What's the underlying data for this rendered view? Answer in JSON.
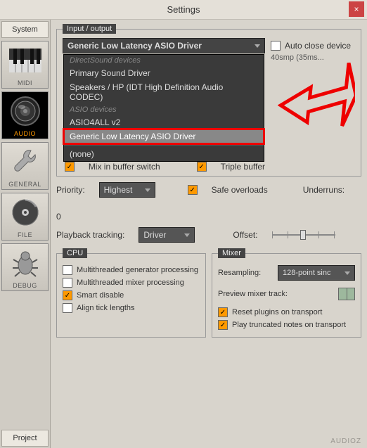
{
  "window": {
    "title": "Settings",
    "close": "×"
  },
  "sidebar": {
    "system": "System",
    "project": "Project",
    "items": [
      {
        "label": "MIDI"
      },
      {
        "label": "AUDIO"
      },
      {
        "label": "GENERAL"
      },
      {
        "label": "FILE"
      },
      {
        "label": "DEBUG"
      }
    ]
  },
  "io": {
    "legend": "Input / output",
    "device_selected": "Generic Low Latency ASIO Driver",
    "dropdown": {
      "group1_header": "DirectSound devices",
      "opt1": "Primary Sound Driver",
      "opt2": "Speakers / HP (IDT High Definition Audio CODEC)",
      "group2_header": "ASIO devices",
      "opt3": "ASIO4ALL v2",
      "opt4": "Generic Low Latency ASIO Driver",
      "opt_none": "(none)"
    },
    "auto_close": "Auto close device",
    "latency_info": "40smp (35ms...",
    "mix_in_buffer": "Mix in buffer switch",
    "triple_buffer": "Triple buffer"
  },
  "priority": {
    "label": "Priority:",
    "value": "Highest",
    "safe_overloads": "Safe overloads",
    "underruns_label": "Underruns:",
    "underruns_value": "0"
  },
  "playback": {
    "label": "Playback tracking:",
    "value": "Driver",
    "offset_label": "Offset:"
  },
  "cpu": {
    "legend": "CPU",
    "opt1": "Multithreaded generator processing",
    "opt2": "Multithreaded mixer processing",
    "opt3": "Smart disable",
    "opt4": "Align tick lengths"
  },
  "mixer": {
    "legend": "Mixer",
    "resampling_label": "Resampling:",
    "resampling_value": "128-point sinc",
    "preview_label": "Preview mixer track:",
    "reset_plugins": "Reset plugins on transport",
    "play_truncated": "Play truncated notes on transport"
  },
  "watermark": "AUDIOZ"
}
